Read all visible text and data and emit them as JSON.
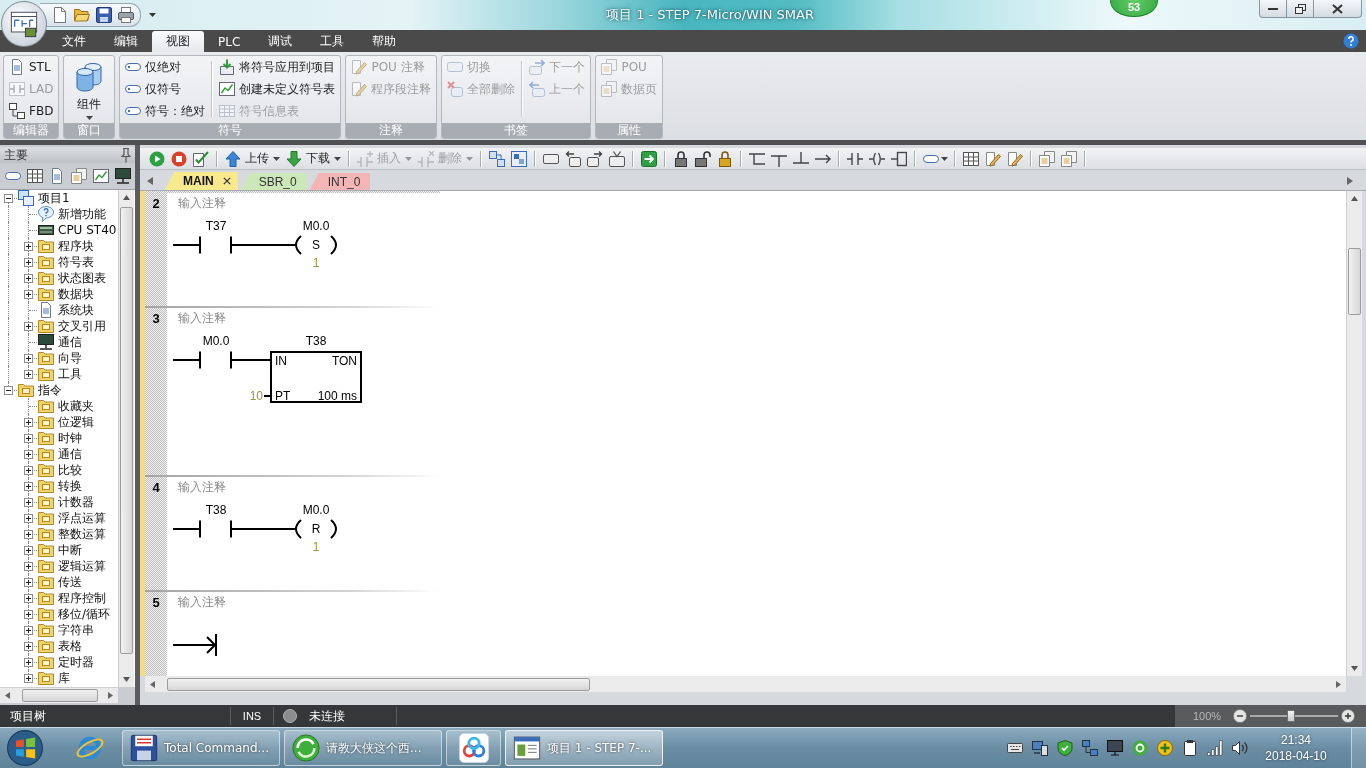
{
  "window": {
    "title": "项目 1 - STEP 7-Micro/WIN SMAR",
    "notification_count": "53"
  },
  "menu_tabs": [
    {
      "label": "文件",
      "selected": false
    },
    {
      "label": "编辑",
      "selected": false
    },
    {
      "label": "视图",
      "selected": true
    },
    {
      "label": "PLC",
      "selected": false
    },
    {
      "label": "调试",
      "selected": false
    },
    {
      "label": "工具",
      "selected": false
    },
    {
      "label": "帮助",
      "selected": false
    }
  ],
  "ribbon_groups": [
    {
      "label": "编辑器",
      "columns": [
        [
          {
            "kind": "small",
            "label": "STL",
            "disabled": false
          },
          {
            "kind": "small",
            "label": "LAD",
            "disabled": true
          },
          {
            "kind": "small",
            "label": "FBD",
            "disabled": false
          }
        ]
      ]
    },
    {
      "label": "窗口",
      "columns": [
        [
          {
            "kind": "large",
            "label": "组件",
            "disabled": false
          }
        ]
      ]
    },
    {
      "label": "符号",
      "columns": [
        [
          {
            "kind": "small",
            "label": "仅绝对",
            "disabled": false
          },
          {
            "kind": "small",
            "label": "仅符号",
            "disabled": false
          },
          {
            "kind": "small",
            "label": "符号：绝对",
            "disabled": false
          }
        ],
        [
          {
            "kind": "small",
            "label": "将符号应用到项目",
            "disabled": false
          },
          {
            "kind": "small",
            "label": "创建未定义符号表",
            "disabled": false
          },
          {
            "kind": "small",
            "label": "符号信息表",
            "disabled": true
          }
        ]
      ]
    },
    {
      "label": "注释",
      "columns": [
        [
          {
            "kind": "small",
            "label": "POU 注释",
            "disabled": true
          },
          {
            "kind": "small",
            "label": "程序段注释",
            "disabled": true
          }
        ]
      ]
    },
    {
      "label": "书签",
      "columns": [
        [
          {
            "kind": "small",
            "label": "切换",
            "disabled": true
          },
          {
            "kind": "small",
            "label": "全部删除",
            "disabled": true
          }
        ],
        [
          {
            "kind": "small",
            "label": "下一个",
            "disabled": true
          },
          {
            "kind": "small",
            "label": "上一个",
            "disabled": true
          }
        ]
      ]
    },
    {
      "label": "属性",
      "columns": [
        [
          {
            "kind": "small",
            "label": "POU",
            "disabled": true
          },
          {
            "kind": "small",
            "label": "数据页",
            "disabled": true
          }
        ]
      ]
    }
  ],
  "project_panel": {
    "title": "主要",
    "tree": [
      {
        "label": "项目1",
        "expanded": true,
        "children": [
          {
            "label": "新增功能"
          },
          {
            "label": "CPU ST40"
          },
          {
            "label": "程序块",
            "expanded": false
          },
          {
            "label": "符号表",
            "expanded": false
          },
          {
            "label": "状态图表",
            "expanded": false
          },
          {
            "label": "数据块",
            "expanded": false
          },
          {
            "label": "系统块"
          },
          {
            "label": "交叉引用",
            "expanded": false
          },
          {
            "label": "通信"
          },
          {
            "label": "向导",
            "expanded": false
          },
          {
            "label": "工具",
            "expanded": false
          }
        ]
      },
      {
        "label": "指令",
        "expanded": true,
        "children": [
          {
            "label": "收藏夹"
          },
          {
            "label": "位逻辑",
            "expanded": false
          },
          {
            "label": "时钟",
            "expanded": false
          },
          {
            "label": "通信",
            "expanded": false
          },
          {
            "label": "比较",
            "expanded": false
          },
          {
            "label": "转换",
            "expanded": false
          },
          {
            "label": "计数器",
            "expanded": false
          },
          {
            "label": "浮点运算",
            "expanded": false
          },
          {
            "label": "整数运算",
            "expanded": false
          },
          {
            "label": "中断",
            "expanded": false
          },
          {
            "label": "逻辑运算",
            "expanded": false
          },
          {
            "label": "传送",
            "expanded": false
          },
          {
            "label": "程序控制",
            "expanded": false
          },
          {
            "label": "移位/循环",
            "expanded": false
          },
          {
            "label": "字符串",
            "expanded": false
          },
          {
            "label": "表格",
            "expanded": false
          },
          {
            "label": "定时器",
            "expanded": false
          },
          {
            "label": "库",
            "expanded": false
          }
        ]
      }
    ]
  },
  "editor": {
    "toolbar_buttons": [
      {
        "label": "上传",
        "disabled": false
      },
      {
        "label": "下载",
        "disabled": false
      },
      {
        "label": "插入",
        "disabled": true
      },
      {
        "label": "删除",
        "disabled": true
      }
    ],
    "tabs": [
      {
        "label": "MAIN",
        "selected": true,
        "color": "#f8ea8c"
      },
      {
        "label": "SBR_0",
        "selected": false,
        "color": "#cde8b8"
      },
      {
        "label": "INT_0",
        "selected": false,
        "color": "#f3b5b5"
      }
    ],
    "networks": [
      {
        "number": "2",
        "comment": "输入注释",
        "kind": "coil",
        "contact": {
          "address": "T37"
        },
        "output": {
          "address": "M0.0",
          "operation": "S",
          "count": "1"
        }
      },
      {
        "number": "3",
        "comment": "输入注释",
        "kind": "box",
        "contact": {
          "address": "M0.0"
        },
        "output": {
          "address": "T38",
          "type": "TON",
          "input_pin": "IN",
          "time_pin": "PT",
          "preset": "10",
          "resolution": "100 ms"
        }
      },
      {
        "number": "4",
        "comment": "输入注释",
        "kind": "coil",
        "contact": {
          "address": "T38"
        },
        "output": {
          "address": "M0.0",
          "operation": "R",
          "count": "1"
        }
      },
      {
        "number": "5",
        "comment": "输入注释",
        "kind": "empty"
      }
    ]
  },
  "status_bar": {
    "panel": "项目树",
    "mode": "INS",
    "connected": false,
    "connection": "未连接",
    "zoom": {
      "value": "100%",
      "level": 0.47
    }
  },
  "taskbar": {
    "items": [
      {
        "kind": "app",
        "label": "Total Command...",
        "selected": false
      },
      {
        "kind": "app",
        "label": "请教大侠这个西...",
        "selected": false
      },
      {
        "kind": "icon",
        "selected": false
      },
      {
        "kind": "app",
        "label": "项目 1 - STEP 7-...",
        "selected": true
      }
    ],
    "clock": {
      "time": "21:34",
      "date": "2018-04-10"
    }
  }
}
